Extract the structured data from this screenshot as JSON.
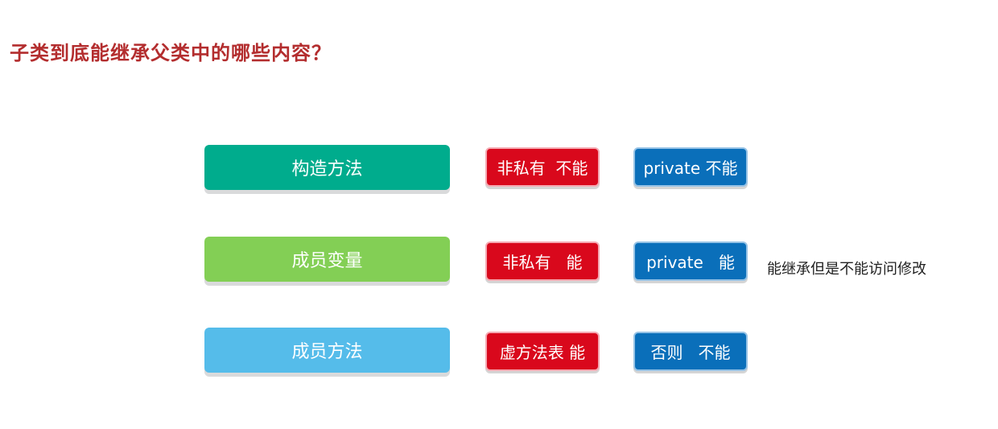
{
  "title": "子类到底能继承父类中的哪些内容？",
  "rows": [
    {
      "category": "构造方法",
      "red_label": "非私有  不能",
      "blue_label": "private 不能"
    },
    {
      "category": "成员变量",
      "red_label": "非私有   能",
      "blue_label": "private   能"
    },
    {
      "category": "成员方法",
      "red_label": "虚方法表 能",
      "blue_label": "否则   不能"
    }
  ],
  "note": "能继承但是不能访问修改",
  "colors": {
    "title": "#b32d2e",
    "row1": "#00ac8d",
    "row2": "#83cf55",
    "row3": "#55bcea",
    "red": "#d9081c",
    "blue": "#0a6fba"
  }
}
